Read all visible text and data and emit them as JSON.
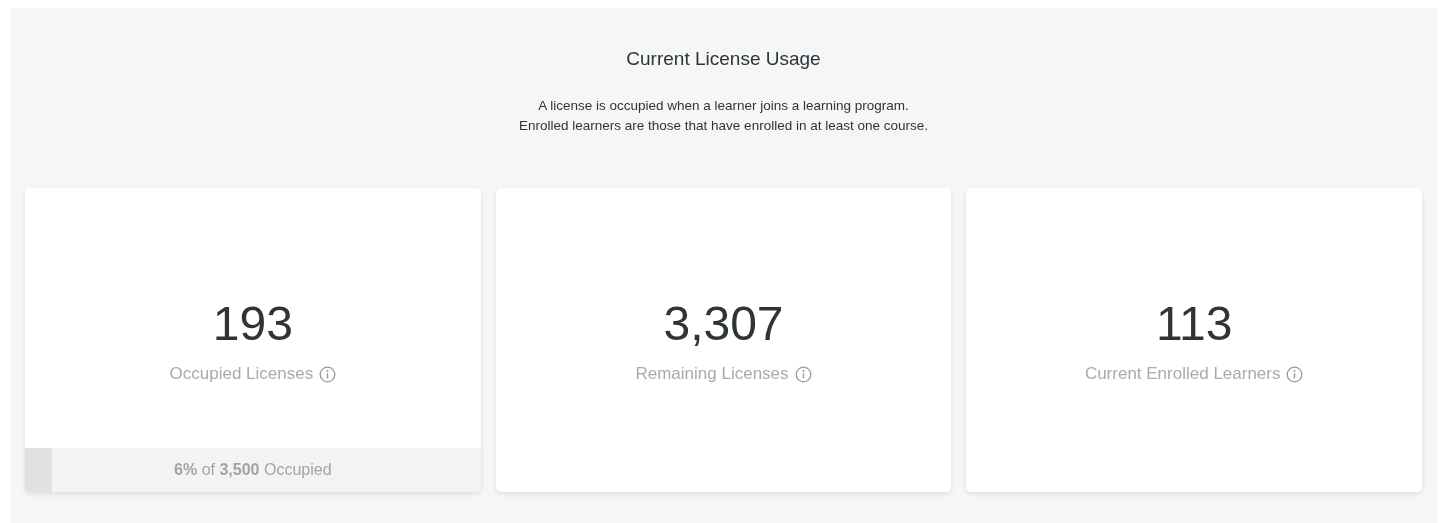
{
  "title": "Current License Usage",
  "description": [
    "A license is occupied when a learner joins a learning program.",
    "Enrolled learners are those that have enrolled in at least one course."
  ],
  "cards": [
    {
      "value": "193",
      "label": "Occupied Licenses",
      "usage": {
        "level": 0.06,
        "text": "**6%** of **3,500** Occupied"
      }
    },
    {
      "value": "3,307",
      "label": "Remaining Licenses"
    },
    {
      "value": "113",
      "label": "Current Enrolled Learners"
    }
  ]
}
